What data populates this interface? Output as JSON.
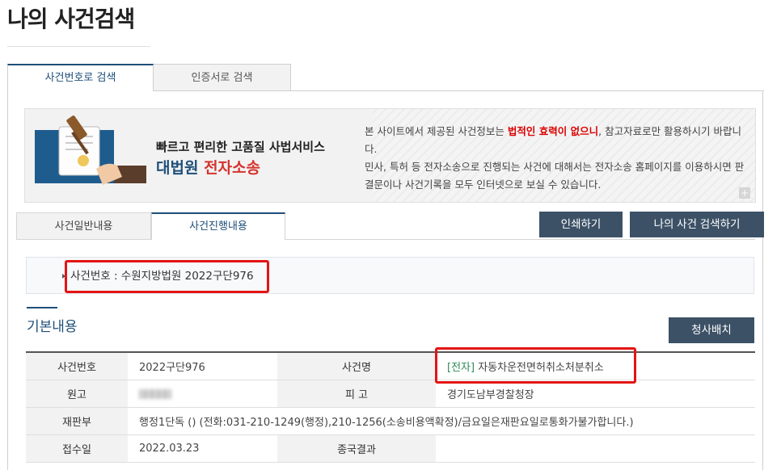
{
  "page": {
    "title": "나의 사건검색"
  },
  "top_tabs": [
    {
      "label": "사건번호로 검색",
      "active": true
    },
    {
      "label": "인증서로 검색",
      "active": false
    }
  ],
  "banner": {
    "line1": "빠르고 편리한 고품질 사법서비스",
    "line2_prefix": "대법원",
    "line2_highlight": "전자소송",
    "desc_part1": "본 사이트에서 제공된 사건정보는 ",
    "desc_highlight": "법적인 효력이 없으니",
    "desc_part2": ", 참고자료로만 활용하시기 바랍니다.",
    "desc_line2": "민사, 특허 등 전자소송으로 진행되는 사건에 대해서는 전자소송 홈페이지를 이용하시면 판결문이나 사건기록을 모두 인터넷으로 보실 수 있습니다.",
    "plus_icon": "+"
  },
  "sub_tabs": [
    {
      "label": "사건일반내용",
      "active": false
    },
    {
      "label": "사건진행내용",
      "active": true
    }
  ],
  "buttons": {
    "print": "인쇄하기",
    "my_search": "나의 사건 검색하기",
    "judge_assign": "청사배치"
  },
  "case_number_line": "사건번호 : 수원지방법원 2022구단976",
  "section_title": "기본내용",
  "info": {
    "case_no_label": "사건번호",
    "case_no": "2022구단976",
    "case_name_label": "사건명",
    "case_name_tag": "[전자]",
    "case_name": "자동차운전면허취소처분취소",
    "plaintiff_label": "원고",
    "defendant_label": "피 고",
    "defendant": "경기도남부경찰청장",
    "court_label": "재판부",
    "court": "행정1단독 () (전화:031-210-1249(행정),210-1256(소송비용액확정)/금요일은재판요일로통화가불가합니다.)",
    "received_label": "접수일",
    "received": "2022.03.23",
    "result_label": "종국결과",
    "result": ""
  },
  "colors": {
    "accent": "#1e4e79",
    "button": "#3c5166",
    "highlight_box": "#e41414",
    "warning_text": "#dd0000"
  }
}
